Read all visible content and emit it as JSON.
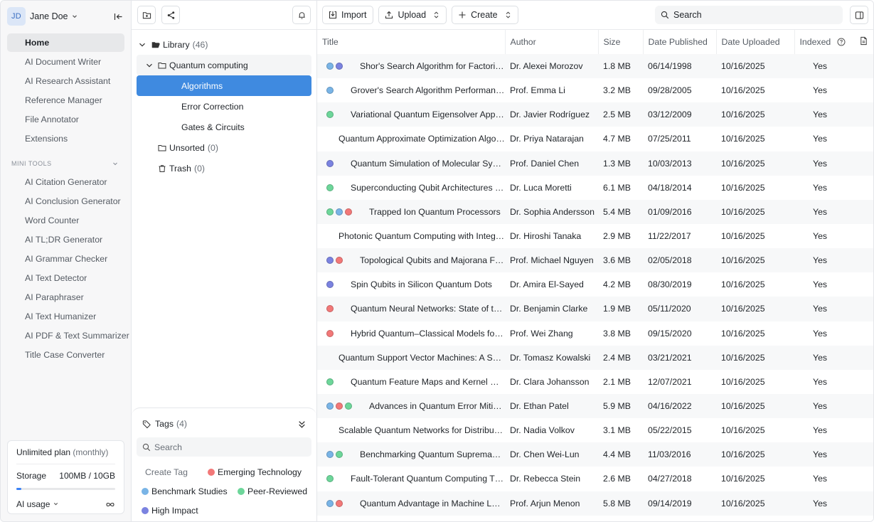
{
  "user": {
    "initials": "JD",
    "name": "Jane Doe"
  },
  "nav": {
    "items": [
      {
        "label": "Home",
        "icon": "home-icon",
        "active": true
      },
      {
        "label": "AI Document Writer",
        "icon": "document-icon"
      },
      {
        "label": "AI Research Assistant",
        "icon": "chat-icon"
      },
      {
        "label": "Reference Manager",
        "icon": "library-icon"
      },
      {
        "label": "File Annotator",
        "icon": "file-edit-icon"
      },
      {
        "label": "Extensions",
        "icon": "grid-icon"
      }
    ],
    "mini_tools_header": "MINI TOOLS",
    "mini_tools": [
      {
        "label": "AI Citation Generator",
        "icon": "citation-icon"
      },
      {
        "label": "AI Conclusion Generator",
        "icon": "conclusion-icon"
      },
      {
        "label": "Word Counter",
        "icon": "lines-icon"
      },
      {
        "label": "AI TL;DR Generator",
        "icon": "tldr-icon"
      },
      {
        "label": "AI Grammar Checker",
        "icon": "grammar-icon"
      },
      {
        "label": "AI Text Detector",
        "icon": "detector-icon"
      },
      {
        "label": "AI Paraphraser",
        "icon": "paraphrase-icon"
      },
      {
        "label": "AI Text Humanizer",
        "icon": "humanizer-icon"
      },
      {
        "label": "AI PDF & Text Summarizer",
        "icon": "summarizer-icon"
      },
      {
        "label": "Title Case Converter",
        "icon": "case-icon"
      }
    ]
  },
  "plan": {
    "name": "Unlimited plan",
    "period": "(monthly)",
    "storage_label": "Storage",
    "storage_value": "100MB / 10GB",
    "storage_fraction": 0.05,
    "usage_label": "AI usage",
    "usage_value_icon": "infinity-icon"
  },
  "tree": {
    "library": {
      "label": "Library",
      "count": "(46)"
    },
    "folder": {
      "label": "Quantum computing"
    },
    "subfolders": [
      {
        "label": "Algorithms",
        "selected": true
      },
      {
        "label": "Error Correction"
      },
      {
        "label": "Gates & Circuits"
      }
    ],
    "unsorted": {
      "label": "Unsorted",
      "count": "(0)"
    },
    "trash": {
      "label": "Trash",
      "count": "(0)"
    }
  },
  "tags": {
    "title": "Tags",
    "count": "(4)",
    "search_placeholder": "Search",
    "create_label": "Create Tag",
    "items": [
      {
        "label": "Emerging Technology",
        "color": "#f27878"
      },
      {
        "label": "Benchmark Studies",
        "color": "#79b4e6"
      },
      {
        "label": "Peer-Reviewed",
        "color": "#6dd69a"
      },
      {
        "label": "High Impact",
        "color": "#7b83e0"
      }
    ]
  },
  "toolbar": {
    "import_label": "Import",
    "upload_label": "Upload",
    "create_label": "Create",
    "search_placeholder": "Search"
  },
  "table": {
    "columns": [
      "Title",
      "Author",
      "Size",
      "Date Published",
      "Date Uploaded",
      "Indexed"
    ],
    "rows": [
      {
        "dots": [
          "#79b4e6",
          "#7b83e0"
        ],
        "type": "file",
        "title": "Shor's Search Algorithm for Factoring Large Integers",
        "author": "Dr. Alexei Morozov",
        "size": "1.8 MB",
        "published": "06/14/1998",
        "uploaded": "10/16/2025",
        "indexed": "Yes"
      },
      {
        "dots": [
          "#79b4e6"
        ],
        "type": "file",
        "title": "Grover's Search Algorithm Performance Analysis",
        "author": "Prof. Emma Li",
        "size": "3.2 MB",
        "published": "09/28/2005",
        "uploaded": "10/16/2025",
        "indexed": "Yes"
      },
      {
        "dots": [
          "#6dd69a"
        ],
        "type": "link",
        "title": "Variational Quantum Eigensolver Applications",
        "author": "Dr. Javier Rodríguez",
        "size": "2.5 MB",
        "published": "03/12/2009",
        "uploaded": "10/16/2025",
        "indexed": "Yes"
      },
      {
        "dots": [],
        "type": "link",
        "title": "Quantum Approximate Optimization Algorithm",
        "author": "Dr. Priya Natarajan",
        "size": "4.7 MB",
        "published": "07/25/2011",
        "uploaded": "10/16/2025",
        "indexed": "Yes"
      },
      {
        "dots": [
          "#7b83e0"
        ],
        "type": "file",
        "title": "Quantum Simulation of Molecular Systems",
        "author": "Prof. Daniel Chen",
        "size": "1.3 MB",
        "published": "10/03/2013",
        "uploaded": "10/16/2025",
        "indexed": "Yes"
      },
      {
        "dots": [
          "#6dd69a"
        ],
        "type": "file",
        "title": "Superconducting Qubit Architectures Review",
        "author": "Dr. Luca Moretti",
        "size": "6.1 MB",
        "published": "04/18/2014",
        "uploaded": "10/16/2025",
        "indexed": "Yes"
      },
      {
        "dots": [
          "#6dd69a",
          "#79b4e6",
          "#f27878"
        ],
        "type": "link",
        "title": "Trapped Ion Quantum Processors",
        "author": "Dr. Sophia Andersson",
        "size": "5.4 MB",
        "published": "01/09/2016",
        "uploaded": "10/16/2025",
        "indexed": "Yes"
      },
      {
        "dots": [],
        "type": "news",
        "title": "Photonic Quantum Computing with Integrated Optics",
        "author": "Dr. Hiroshi Tanaka",
        "size": "2.9 MB",
        "published": "11/22/2017",
        "uploaded": "10/16/2025",
        "indexed": "Yes"
      },
      {
        "dots": [
          "#7b83e0",
          "#f27878"
        ],
        "type": "file",
        "title": "Topological Qubits and Majorana Fermions",
        "author": "Prof. Michael Nguyen",
        "size": "3.6 MB",
        "published": "02/05/2018",
        "uploaded": "10/16/2025",
        "indexed": "Yes"
      },
      {
        "dots": [
          "#7b83e0"
        ],
        "type": "file",
        "title": "Spin Qubits in Silicon Quantum Dots",
        "author": "Dr. Amira El-Sayed",
        "size": "4.2 MB",
        "published": "08/30/2019",
        "uploaded": "10/16/2025",
        "indexed": "Yes"
      },
      {
        "dots": [
          "#f27878"
        ],
        "type": "book",
        "title": "Quantum Neural Networks: State of the Art",
        "author": "Dr. Benjamin Clarke",
        "size": "1.9 MB",
        "published": "05/11/2020",
        "uploaded": "10/16/2025",
        "indexed": "Yes"
      },
      {
        "dots": [
          "#f27878"
        ],
        "type": "file",
        "title": "Hybrid Quantum–Classical Models for Learning",
        "author": "Prof. Wei Zhang",
        "size": "3.8 MB",
        "published": "09/15/2020",
        "uploaded": "10/16/2025",
        "indexed": "Yes"
      },
      {
        "dots": [],
        "type": "book",
        "title": "Quantum Support Vector Machines: A Survey",
        "author": "Dr. Tomasz Kowalski",
        "size": "2.4 MB",
        "published": "03/21/2021",
        "uploaded": "10/16/2025",
        "indexed": "Yes"
      },
      {
        "dots": [
          "#6dd69a"
        ],
        "type": "file",
        "title": "Quantum Feature Maps and Kernel Methods",
        "author": "Dr. Clara Johansson",
        "size": "2.1 MB",
        "published": "12/07/2021",
        "uploaded": "10/16/2025",
        "indexed": "Yes"
      },
      {
        "dots": [
          "#79b4e6",
          "#f27878",
          "#6dd69a"
        ],
        "type": "book",
        "title": "Advances in Quantum Error Mitigation",
        "author": "Dr. Ethan Patel",
        "size": "5.9 MB",
        "published": "04/16/2022",
        "uploaded": "10/16/2025",
        "indexed": "Yes"
      },
      {
        "dots": [],
        "type": "database",
        "title": "Scalable Quantum Networks for Distributed Computing",
        "author": "Dr. Nadia Volkov",
        "size": "3.1 MB",
        "published": "05/22/2015",
        "uploaded": "10/16/2025",
        "indexed": "Yes"
      },
      {
        "dots": [
          "#79b4e6",
          "#6dd69a"
        ],
        "type": "mic",
        "title": "Benchmarking Quantum Supremacy Experiments",
        "author": "Dr. Chen Wei-Lun",
        "size": "4.4 MB",
        "published": "11/03/2016",
        "uploaded": "10/16/2025",
        "indexed": "Yes"
      },
      {
        "dots": [
          "#6dd69a"
        ],
        "type": "file",
        "title": "Fault-Tolerant Quantum Computing Thresholds",
        "author": "Dr. Rebecca Stein",
        "size": "2.6 MB",
        "published": "04/27/2018",
        "uploaded": "10/16/2025",
        "indexed": "Yes"
      },
      {
        "dots": [
          "#79b4e6",
          "#f27878"
        ],
        "type": "book",
        "title": "Quantum Advantage in Machine Learning",
        "author": "Prof. Arjun Menon",
        "size": "5.8 MB",
        "published": "09/14/2019",
        "uploaded": "10/16/2025",
        "indexed": "Yes"
      }
    ]
  },
  "colors": {
    "accent": "#3f8ae0",
    "indexed_green": "#2f9e5c"
  }
}
